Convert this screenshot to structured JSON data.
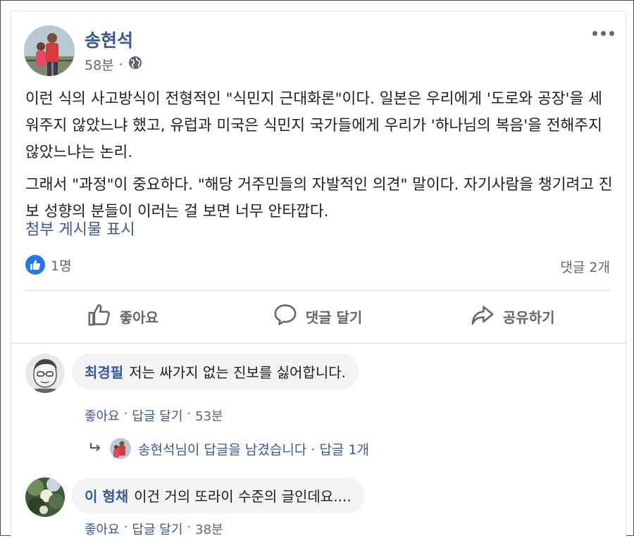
{
  "post": {
    "author": "송현석",
    "time": "58분",
    "meta_sep": "·",
    "privacy_icon": "globe-icon",
    "paragraphs": [
      "이런 식의 사고방식이 전형적인 \"식민지 근대화론\"이다. 일본은 우리에게 '도로와 공장'을 세워주지 않았느냐 했고, 유럽과 미국은 식민지 국가들에게 우리가 '하나님의 복음'을 전해주지 않았느냐는 논리.",
      "그래서 \"과정\"이 중요하다. \"해당 거주민들의 자발적인 의견\" 말이다. 자기사람을 챙기려고 진보 성향의 분들이 이러는 걸 보면 너무 안타깝다."
    ],
    "see_attachment": "첨부 게시물 표시",
    "reaction_count": "1명",
    "comment_count": "댓글 2개"
  },
  "actions": {
    "like": "좋아요",
    "comment": "댓글 달기",
    "share": "공유하기"
  },
  "comments": [
    {
      "name": "최경필",
      "text": "저는 싸가지 없는 진보를 싫어합니다.",
      "like": "좋아요",
      "reply": "답글 달기",
      "sep": "·",
      "time": "53분",
      "reply_summary": "송현석님이 답글을 남겼습니다 · 답글 1개"
    },
    {
      "name": "이 형채",
      "text": "이건 거의 또라이 수준의 글인데요....",
      "like": "좋아요",
      "reply": "답글 달기",
      "sep": "·",
      "time": "38분"
    }
  ],
  "colors": {
    "link": "#385898",
    "author": "#365899",
    "like_blue": "#2078f4",
    "muted": "#606770",
    "bubble": "#f2f3f5"
  }
}
